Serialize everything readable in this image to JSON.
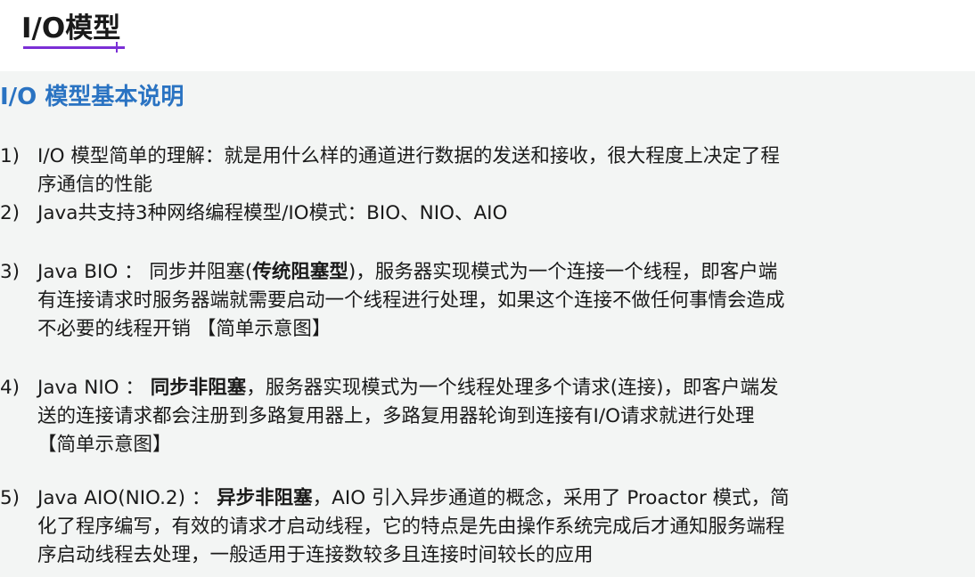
{
  "header": {
    "title": "I/O模型"
  },
  "section": {
    "heading": "I/O 模型基本说明"
  },
  "items": [
    {
      "num": "1)",
      "line1": "I/O 模型简单的理解：就是用什么样的通道进行数据的发送和接收，很大程度上决定了程",
      "line2": "序通信的性能"
    },
    {
      "num": "2)",
      "line1": "Java共支持3种网络编程模型/IO模式：BIO、NIO、AIO"
    },
    {
      "num": "3)",
      "line1_a": "Java BIO ： 同步并阻塞(",
      "line1_bold": "传统阻塞型",
      "line1_b": ")，服务器实现模式为一个连接一个线程，即客户端",
      "line2": "有连接请求时服务器端就需要启动一个线程进行处理，如果这个连接不做任何事情会造成",
      "line3": "不必要的线程开销 【简单示意图】"
    },
    {
      "num": "4)",
      "line1_a": "Java NIO ： ",
      "line1_bold": "同步非阻塞",
      "line1_b": "，服务器实现模式为一个线程处理多个请求(连接)，即客户端发",
      "line2": "送的连接请求都会注册到多路复用器上，多路复用器轮询到连接有I/O请求就进行处理",
      "line3": "【简单示意图】"
    },
    {
      "num": "5)",
      "line1_a": "Java AIO(NIO.2) ： ",
      "line1_bold": "异步非阻塞",
      "line1_b": "，AIO 引入异步通道的概念，采用了 Proactor 模式，简",
      "line2": "化了程序编写，有效的请求才启动线程，它的特点是先由操作系统完成后才通知服务端程",
      "line3": "序启动线程去处理，一般适用于连接数较多且连接时间较长的应用"
    }
  ],
  "colors": {
    "heading": "#2a73c2",
    "underline": "#7b2fd6",
    "panel_bg": "#f3f5f4",
    "corner_accent": "#1fb89a"
  }
}
